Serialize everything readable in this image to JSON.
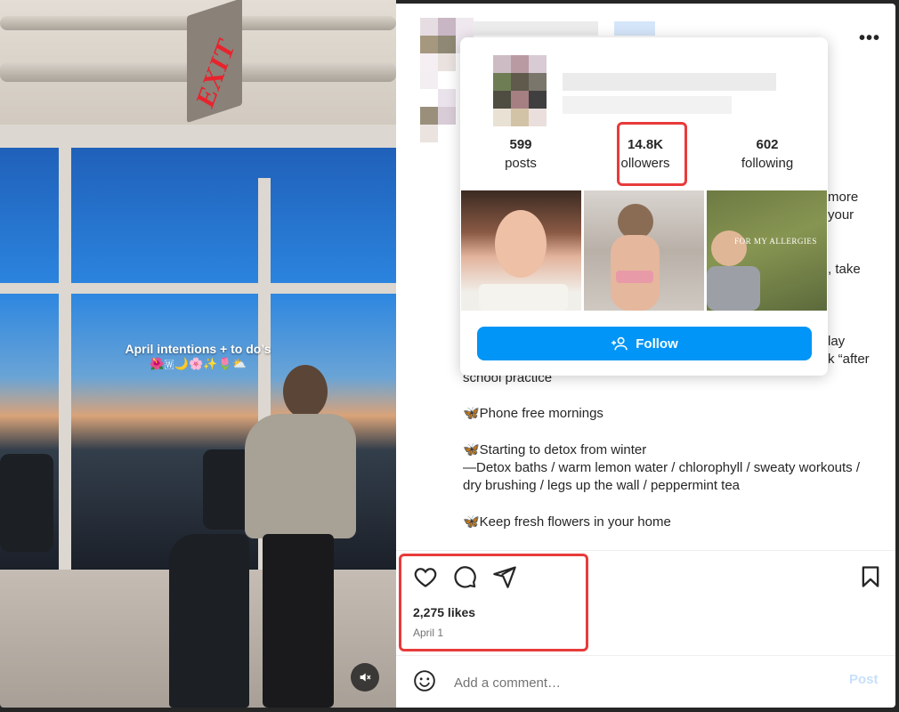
{
  "media": {
    "exit_sign": "EXIT",
    "overlay_title": "April intentions + to do’s",
    "overlay_emoji": "🌺🇼🌙🌸✨🌷⛅",
    "mute_icon": "muted-speaker-icon"
  },
  "hover_card": {
    "stats": [
      {
        "value": "599",
        "label": "posts"
      },
      {
        "value": "14.8K",
        "label": "ollowers"
      },
      {
        "value": "602",
        "label": "following"
      }
    ],
    "thumb2_overlay": "FOR MY ALLERGIES",
    "follow_label": "Follow",
    "follow_icon": "add-person-icon"
  },
  "caption": {
    "fragments": [
      "more",
      "your",
      ", take",
      "lay",
      "k “after",
      "school practice"
    ],
    "lines": [
      "🦋Phone free mornings",
      "🦋Starting to detox from winter",
      "—Detox baths / warm lemon water / chlorophyll / sweaty workouts /",
      "dry brushing / legs up the wall / peppermint tea",
      "🦋Keep fresh flowers in your home"
    ]
  },
  "actions": {
    "likes": "2,275 likes",
    "date": "April 1"
  },
  "comment": {
    "placeholder": "Add a comment…",
    "post_label": "Post"
  },
  "colors": {
    "follow_button": "#0095f6",
    "highlight": "#e83b3b",
    "post_disabled": "#c7e0fb"
  }
}
